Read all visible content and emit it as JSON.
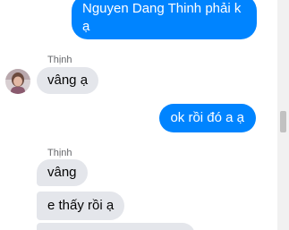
{
  "conversation": {
    "messages": [
      {
        "direction": "outgoing",
        "lines": [
          "Nguyen Dang Thinh phải k",
          "ạ"
        ]
      },
      {
        "direction": "incoming",
        "sender": "Thịnh",
        "text": "vâng ạ"
      },
      {
        "direction": "outgoing",
        "text": "ok rồi đó a ạ"
      },
      {
        "direction": "incoming",
        "sender": "Thịnh",
        "text": "vâng"
      },
      {
        "direction": "incoming",
        "text": "e thấy rồi ạ"
      }
    ]
  },
  "colors": {
    "outgoing_bubble": "#0084ff",
    "incoming_bubble": "#e4e6eb",
    "sender_label": "#65676b"
  },
  "icons": {
    "avatar": "contact-avatar-icon"
  }
}
